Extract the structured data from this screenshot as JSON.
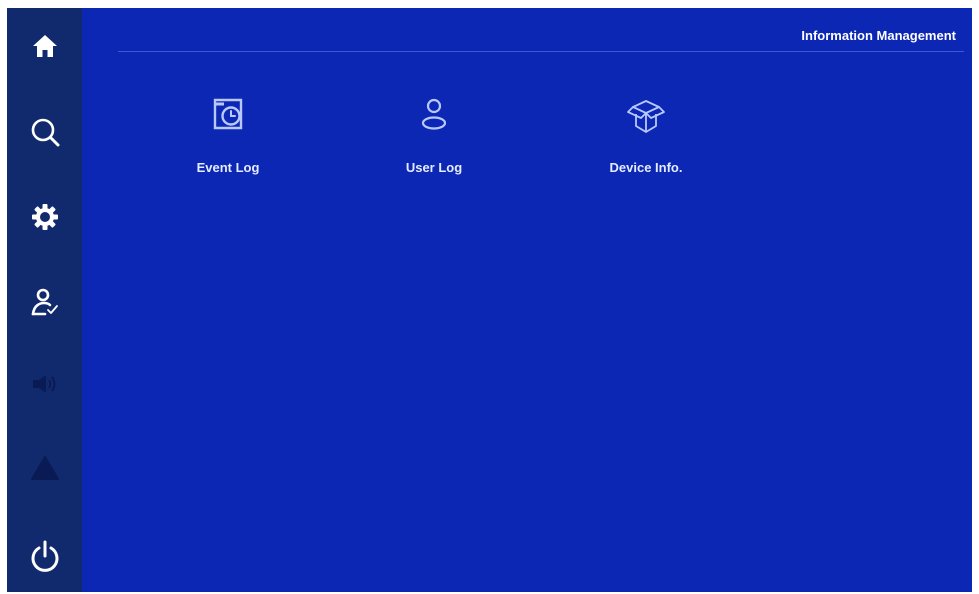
{
  "header": {
    "title": "Information Management"
  },
  "sidebar": {
    "items": [
      {
        "name": "home",
        "icon": "home-icon"
      },
      {
        "name": "search",
        "icon": "search-icon"
      },
      {
        "name": "settings",
        "icon": "gear-icon"
      },
      {
        "name": "user-management",
        "icon": "user-check-icon"
      },
      {
        "name": "sound",
        "icon": "speaker-icon"
      },
      {
        "name": "alarm",
        "icon": "warning-icon"
      },
      {
        "name": "power",
        "icon": "power-icon"
      }
    ]
  },
  "main": {
    "tiles": [
      {
        "label": "Event Log",
        "icon": "event-log-icon"
      },
      {
        "label": "User Log",
        "icon": "user-icon"
      },
      {
        "label": "Device Info.",
        "icon": "box-icon"
      }
    ]
  },
  "colors": {
    "background": "#0b27b4",
    "sidebar": "#112a6e",
    "icon": "#ffffff",
    "tile_icon": "#b8c8ff",
    "disabled_icon": "#0a1a55"
  }
}
